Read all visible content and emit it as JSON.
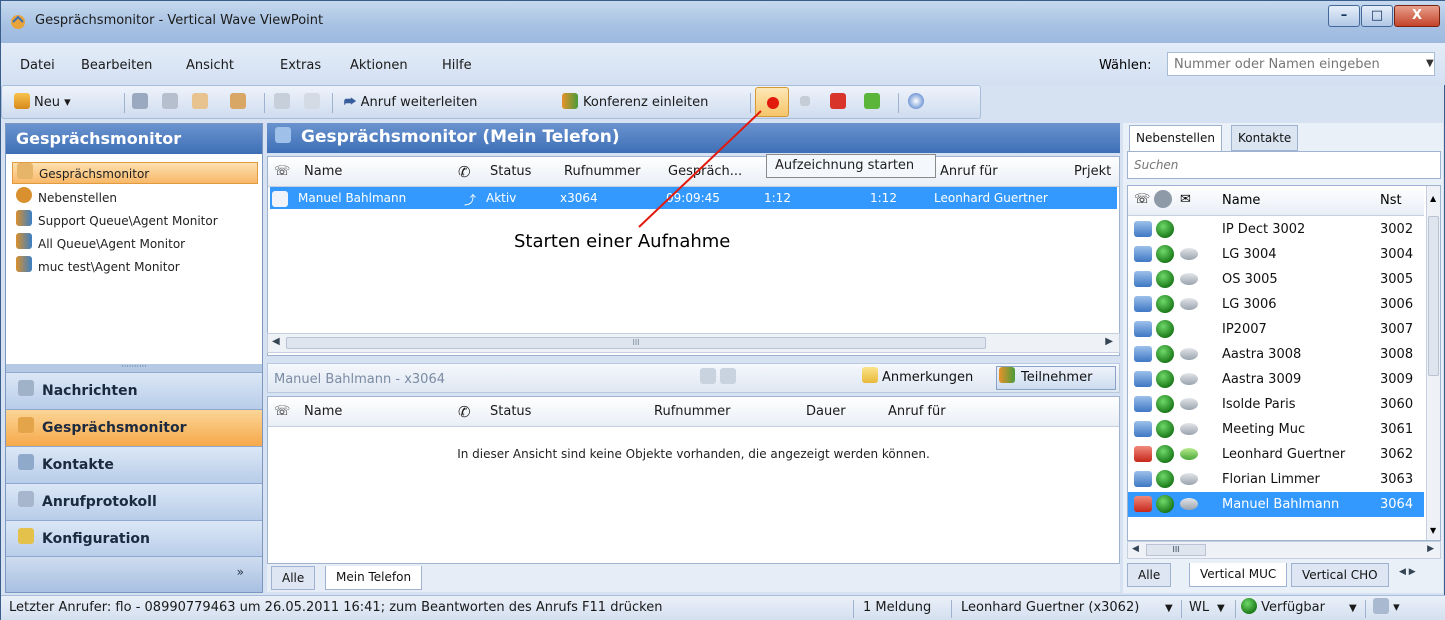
{
  "window": {
    "title": "Gesprächsmonitor - Vertical Wave ViewPoint",
    "min": "–",
    "max": "□",
    "close": "X"
  },
  "menu": [
    "Datei",
    "Bearbeiten",
    "Ansicht",
    "Extras",
    "Aktionen",
    "Hilfe"
  ],
  "dial": {
    "label": "Wählen:",
    "placeholder": "Nummer oder Namen eingeben"
  },
  "toolbar": {
    "new_label": "Neu",
    "forward_label": "Anruf weiterleiten",
    "conference_label": "Konferenz einleiten"
  },
  "tooltip": "Aufzeichnung starten",
  "callout": "Starten einer Aufnahme",
  "left": {
    "header": "Gesprächsmonitor",
    "tree": [
      "Gesprächsmonitor",
      "Nebenstellen",
      "Support Queue\\Agent Monitor",
      "All Queue\\Agent Monitor",
      "muc test\\Agent Monitor"
    ],
    "nav": [
      "Nachrichten",
      "Gesprächsmonitor",
      "Kontakte",
      "Anrufprotokoll",
      "Konfiguration"
    ],
    "more": "»"
  },
  "center": {
    "header": "Gesprächsmonitor (Mein Telefon)",
    "columns": [
      "Name",
      "Status",
      "Rufnummer",
      "Gespräch...",
      "Anruf für",
      "Prjekt"
    ],
    "call": {
      "name": "Manuel Bahlmann",
      "status": "Aktiv",
      "number": "x3064",
      "time": "09:09:45",
      "d1": "1:12",
      "d2": "1:12",
      "for": "Leonhard Guertner"
    },
    "scroll_thumb": "III",
    "sub_title": "Manuel Bahlmann - x3064",
    "notes_button": "Anmerkungen",
    "participants_button": "Teilnehmer",
    "part_columns": [
      "Name",
      "Status",
      "Rufnummer",
      "Dauer",
      "Anruf für"
    ],
    "empty_message": "In dieser Ansicht sind keine Objekte vorhanden, die angezeigt werden können.",
    "tabs": [
      "Alle",
      "Mein Telefon"
    ]
  },
  "right": {
    "tabs": [
      "Nebenstellen",
      "Kontakte"
    ],
    "search_placeholder": "Suchen",
    "columns": {
      "name": "Name",
      "nst": "Nst"
    },
    "rows": [
      {
        "name": "IP Dect 3002",
        "nst": "3002",
        "phone": "blue",
        "chat": "none"
      },
      {
        "name": "LG 3004",
        "nst": "3004",
        "phone": "blue",
        "chat": "grey"
      },
      {
        "name": "OS 3005",
        "nst": "3005",
        "phone": "blue",
        "chat": "grey"
      },
      {
        "name": "LG 3006",
        "nst": "3006",
        "phone": "blue",
        "chat": "grey"
      },
      {
        "name": "IP2007",
        "nst": "3007",
        "phone": "blue",
        "chat": "none"
      },
      {
        "name": "Aastra 3008",
        "nst": "3008",
        "phone": "blue",
        "chat": "grey"
      },
      {
        "name": "Aastra 3009",
        "nst": "3009",
        "phone": "blue",
        "chat": "grey"
      },
      {
        "name": "Isolde Paris",
        "nst": "3060",
        "phone": "blue",
        "chat": "grey"
      },
      {
        "name": "Meeting Muc",
        "nst": "3061",
        "phone": "blue",
        "chat": "grey"
      },
      {
        "name": "Leonhard Guertner",
        "nst": "3062",
        "phone": "red",
        "chat": "green"
      },
      {
        "name": "Florian Limmer",
        "nst": "3063",
        "phone": "blue",
        "chat": "grey"
      },
      {
        "name": "Manuel Bahlmann",
        "nst": "3064",
        "phone": "red",
        "chat": "grey",
        "selected": true
      }
    ],
    "scroll_thumb": "III",
    "bottom_tabs": [
      "Alle",
      "Vertical MUC",
      "Vertical CHO"
    ]
  },
  "status": {
    "last_caller": "Letzter Anrufer: flo  - 08990779463 um 26.05.2011 16:41; zum Beantworten des Anrufs F11 drücken",
    "messages": "1 Meldung",
    "user": "Leonhard Guertner (x3062)",
    "wl": "WL",
    "availability": "Verfügbar"
  },
  "colors": {
    "accent": "#3e6fb6",
    "selected": "#3399ff",
    "active_nav": "#f6a94a",
    "record": "#e21a0d"
  }
}
